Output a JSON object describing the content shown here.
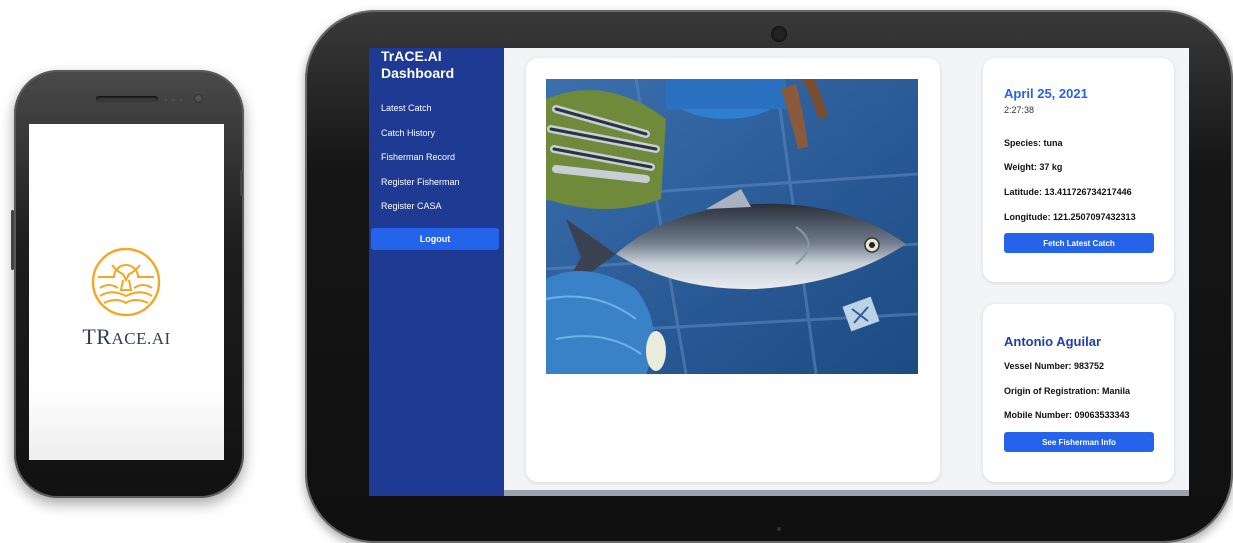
{
  "phone": {
    "brand_main": "TR",
    "brand_small": "ACE.AI",
    "logo_icon": "whale-tail-wave-icon",
    "accent_color": "#f5a623"
  },
  "sidebar": {
    "title_line1": "TrACE.AI",
    "title_line2": "Dashboard",
    "items": [
      {
        "label": "Latest Catch"
      },
      {
        "label": "Catch History"
      },
      {
        "label": "Fisherman Record"
      },
      {
        "label": "Register Fisherman"
      },
      {
        "label": "Register CASA"
      }
    ],
    "logout_label": "Logout",
    "bg_color": "#1f3a93"
  },
  "catch": {
    "date": "April 25, 2021",
    "time": "2:27:38",
    "species": "Species: tuna",
    "weight": "Weight: 37 kg",
    "latitude": "Latitude: 13.411726734217446",
    "longitude": "Longitude: 121.2507097432313",
    "fetch_label": "Fetch Latest Catch",
    "photo_icon": "tuna-catch-photo"
  },
  "fisherman": {
    "name": "Antonio Aguilar",
    "vessel": "Vessel Number: 983752",
    "origin": "Origin of Registration: Manila",
    "mobile": "Mobile Number: 09063533343",
    "info_label": "See Fisherman Info"
  },
  "colors": {
    "primary_button": "#2563eb",
    "heading_blue": "#2563eb"
  }
}
